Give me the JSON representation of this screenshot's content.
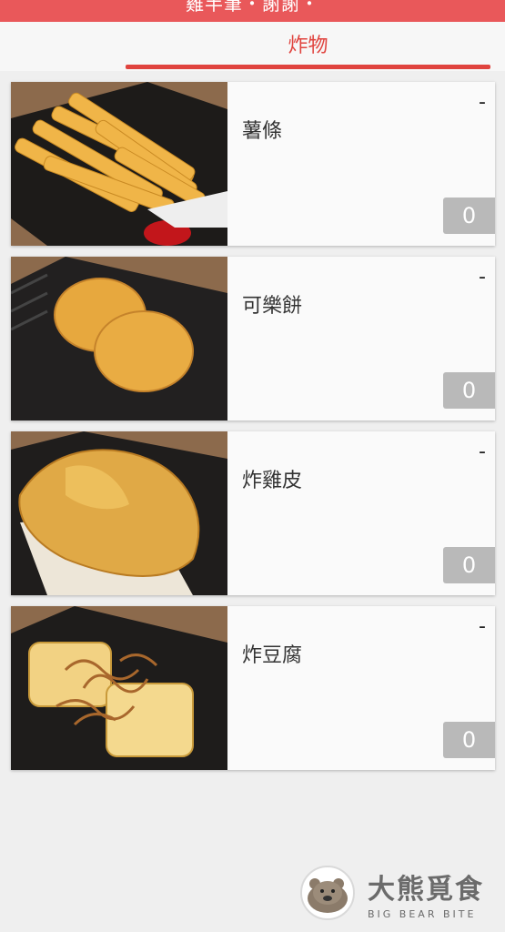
{
  "header": {
    "title": "雞半筆・謝謝・"
  },
  "tabs": [
    {
      "label": "炸物",
      "active": true
    }
  ],
  "items": [
    {
      "name": "薯條",
      "minus": "-",
      "qty": "0"
    },
    {
      "name": "可樂餅",
      "minus": "-",
      "qty": "0"
    },
    {
      "name": "炸雞皮",
      "minus": "-",
      "qty": "0"
    },
    {
      "name": "炸豆腐",
      "minus": "-",
      "qty": "0"
    }
  ],
  "watermark": {
    "cn": "大熊覓食",
    "en": "BIG BEAR BITE"
  },
  "colors": {
    "accent": "#e0443f",
    "header": "#e9585a",
    "qty_badge": "#b9b9b9"
  }
}
